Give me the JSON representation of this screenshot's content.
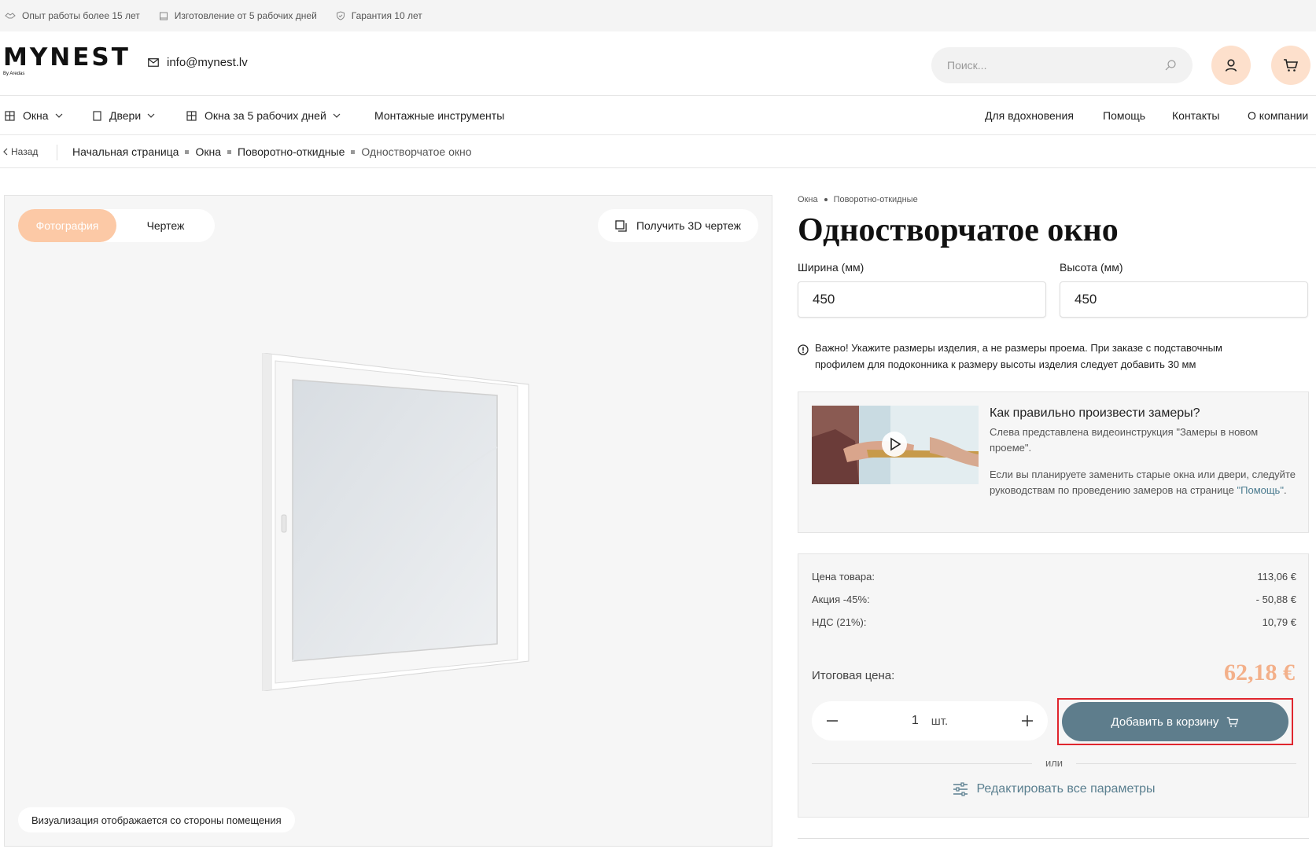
{
  "topbar": {
    "items": [
      {
        "icon": "handshake-icon",
        "label": "Опыт работы более 15 лет"
      },
      {
        "icon": "calendar-icon",
        "label": "Изготовление от 5 рабочих дней"
      },
      {
        "icon": "shield-icon",
        "label": "Гарантия 10 лет"
      }
    ]
  },
  "header": {
    "logo": "MYNEST",
    "logo_sub": "By Aredas",
    "email": "info@mynest.lv",
    "search_placeholder": "Поиск..."
  },
  "nav": {
    "left": [
      {
        "label": "Окна",
        "icon": "window-icon",
        "dropdown": true
      },
      {
        "label": "Двери",
        "icon": "door-icon",
        "dropdown": true
      },
      {
        "label": "Окна за 5 рабочих дней",
        "icon": "window-icon",
        "dropdown": true
      },
      {
        "label": "Монтажные инструменты"
      }
    ],
    "right": [
      "Для вдохновения",
      "Помощь",
      "Контакты",
      "О компании"
    ]
  },
  "breadcrumbs": {
    "back": "Назад",
    "items": [
      "Начальная страница",
      "Окна",
      "Поворотно-откидные",
      "Одностворчатое окно"
    ]
  },
  "gallery": {
    "tabs": [
      "Фотография",
      "Чертеж"
    ],
    "active_tab": "Фотография",
    "get3d": "Получить 3D чертеж",
    "note": "Визуализация отображается со стороны помещения"
  },
  "product": {
    "category": "Окна",
    "subcategory": "Поворотно-откидные",
    "title": "Одностворчатое окно",
    "width_label": "Ширина (мм)",
    "width_value": "450",
    "height_label": "Высота (мм)",
    "height_value": "450",
    "warning_line1": "Важно! Укажите размеры изделия, а не размеры проема. При заказе с подставочным",
    "warning_line2": "профилем для подоконника к размеру высоты изделия следует добавить 30 мм"
  },
  "video": {
    "title": "Как правильно произвести замеры?",
    "p1": "Слева представлена видеоинструкция \"Замеры в новом проеме\".",
    "p2_pre": "Если вы планируете заменить старые окна или двери, следуйте руководствам по проведению замеров на странице ",
    "p2_link": "\"Помощь\"",
    "p2_post": "."
  },
  "price": {
    "rows": [
      {
        "label": "Цена товара:",
        "value": "113,06 €"
      },
      {
        "label": "Акция -45%:",
        "value": "- 50,88 €"
      },
      {
        "label": "НДС (21%):",
        "value": "10,79 €"
      }
    ],
    "total_label": "Итоговая цена:",
    "total_value": "62,18 €",
    "qty_value": "1",
    "qty_unit": "шт.",
    "add_to_cart": "Добавить в корзину",
    "or": "или",
    "edit_all": "Редактировать все параметры"
  },
  "colors": {
    "accent_peach": "#fcc9a6",
    "button_slate": "#5e7d8c",
    "price_total": "#f3b08a",
    "highlight_red": "#e0262e"
  }
}
